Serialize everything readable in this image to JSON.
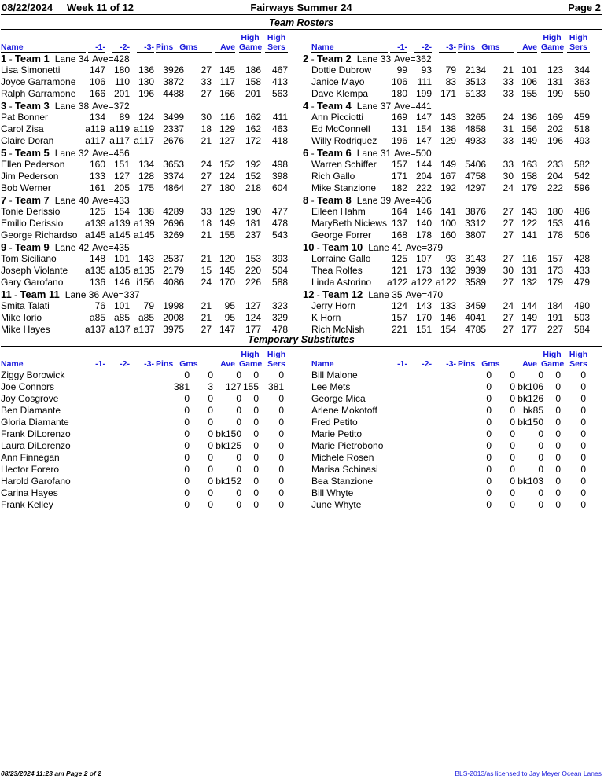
{
  "header": {
    "date": "08/22/2024",
    "week": "Week 11 of 12",
    "league": "Fairways Summer 24",
    "page": "Page 2"
  },
  "sections": {
    "rosters_title": "Team Rosters",
    "subs_title": "Temporary Substitutes"
  },
  "columns": {
    "name": "Name",
    "g1": "-1-",
    "g2": "-2-",
    "g3": "-3-",
    "pins": "Pins",
    "gms": "Gms",
    "ave": "Ave",
    "high_game": "High Game",
    "high_game_1": "High",
    "high_game_2": "Game",
    "high_sers_1": "High",
    "high_sers_2": "Sers"
  },
  "teams_left": [
    {
      "num": "1",
      "name": "Team 1",
      "lane": "Lane 34",
      "ave": "Ave=428",
      "bowlers": [
        {
          "name": "Lisa Simonetti",
          "g1": "147",
          "g2": "180",
          "g3": "136",
          "pins": "3926",
          "gms": "27",
          "ave": "145",
          "hg": "186",
          "hs": "467"
        },
        {
          "name": "Joyce Garramone",
          "g1": "106",
          "g2": "110",
          "g3": "130",
          "pins": "3872",
          "gms": "33",
          "ave": "117",
          "hg": "158",
          "hs": "413"
        },
        {
          "name": "Ralph Garramone",
          "g1": "166",
          "g2": "201",
          "g3": "196",
          "pins": "4488",
          "gms": "27",
          "ave": "166",
          "hg": "201",
          "hs": "563"
        }
      ]
    },
    {
      "num": "3",
      "name": "Team 3",
      "lane": "Lane 38",
      "ave": "Ave=372",
      "bowlers": [
        {
          "name": "Pat Bonner",
          "g1": "134",
          "g2": "89",
          "g3": "124",
          "pins": "3499",
          "gms": "30",
          "ave": "116",
          "hg": "162",
          "hs": "411"
        },
        {
          "name": "Carol Zisa",
          "g1": "a119",
          "g2": "a119",
          "g3": "a119",
          "pins": "2337",
          "gms": "18",
          "ave": "129",
          "hg": "162",
          "hs": "463"
        },
        {
          "name": "Claire Doran",
          "g1": "a117",
          "g2": "a117",
          "g3": "a117",
          "pins": "2676",
          "gms": "21",
          "ave": "127",
          "hg": "172",
          "hs": "418"
        }
      ]
    },
    {
      "num": "5",
      "name": "Team 5",
      "lane": "Lane 32",
      "ave": "Ave=456",
      "bowlers": [
        {
          "name": "Ellen Pederson",
          "g1": "160",
          "g2": "151",
          "g3": "134",
          "pins": "3653",
          "gms": "24",
          "ave": "152",
          "hg": "192",
          "hs": "498"
        },
        {
          "name": "Jim Pederson",
          "g1": "133",
          "g2": "127",
          "g3": "128",
          "pins": "3374",
          "gms": "27",
          "ave": "124",
          "hg": "152",
          "hs": "398"
        },
        {
          "name": "Bob Werner",
          "g1": "161",
          "g2": "205",
          "g3": "175",
          "pins": "4864",
          "gms": "27",
          "ave": "180",
          "hg": "218",
          "hs": "604"
        }
      ]
    },
    {
      "num": "7",
      "name": "Team 7",
      "lane": "Lane 40",
      "ave": "Ave=433",
      "bowlers": [
        {
          "name": "Tonie Derissio",
          "g1": "125",
          "g2": "154",
          "g3": "138",
          "pins": "4289",
          "gms": "33",
          "ave": "129",
          "hg": "190",
          "hs": "477"
        },
        {
          "name": "Emilio Derissio",
          "g1": "a139",
          "g2": "a139",
          "g3": "a139",
          "pins": "2696",
          "gms": "18",
          "ave": "149",
          "hg": "181",
          "hs": "478"
        },
        {
          "name": "George Richardso",
          "g1": "a145",
          "g2": "a145",
          "g3": "a145",
          "pins": "3269",
          "gms": "21",
          "ave": "155",
          "hg": "237",
          "hs": "543"
        }
      ]
    },
    {
      "num": "9",
      "name": "Team 9",
      "lane": "Lane 42",
      "ave": "Ave=435",
      "bowlers": [
        {
          "name": "Tom Siciliano",
          "g1": "148",
          "g2": "101",
          "g3": "143",
          "pins": "2537",
          "gms": "21",
          "ave": "120",
          "hg": "153",
          "hs": "393"
        },
        {
          "name": "Joseph Violante",
          "g1": "a135",
          "g2": "a135",
          "g3": "a135",
          "pins": "2179",
          "gms": "15",
          "ave": "145",
          "hg": "220",
          "hs": "504"
        },
        {
          "name": "Gary Garofano",
          "g1": "136",
          "g2": "146",
          "g3": "i156",
          "pins": "4086",
          "gms": "24",
          "ave": "170",
          "hg": "226",
          "hs": "588"
        }
      ]
    },
    {
      "num": "11",
      "name": "Team 11",
      "lane": "Lane 36",
      "ave": "Ave=337",
      "bowlers": [
        {
          "name": "Smita Talati",
          "g1": "76",
          "g2": "101",
          "g3": "79",
          "pins": "1998",
          "gms": "21",
          "ave": "95",
          "hg": "127",
          "hs": "323"
        },
        {
          "name": "Mike Iorio",
          "g1": "a85",
          "g2": "a85",
          "g3": "a85",
          "pins": "2008",
          "gms": "21",
          "ave": "95",
          "hg": "124",
          "hs": "329"
        },
        {
          "name": "Mike Hayes",
          "g1": "a137",
          "g2": "a137",
          "g3": "a137",
          "pins": "3975",
          "gms": "27",
          "ave": "147",
          "hg": "177",
          "hs": "478"
        }
      ]
    }
  ],
  "teams_right": [
    {
      "num": "2",
      "name": "Team 2",
      "lane": "Lane 33",
      "ave": "Ave=362",
      "bowlers": [
        {
          "name": "Dottie Dubrow",
          "g1": "99",
          "g2": "93",
          "g3": "79",
          "pins": "2134",
          "gms": "21",
          "ave": "101",
          "hg": "123",
          "hs": "344"
        },
        {
          "name": "Janice Mayo",
          "g1": "106",
          "g2": "111",
          "g3": "83",
          "pins": "3513",
          "gms": "33",
          "ave": "106",
          "hg": "131",
          "hs": "363"
        },
        {
          "name": "Dave Klempa",
          "g1": "180",
          "g2": "199",
          "g3": "171",
          "pins": "5133",
          "gms": "33",
          "ave": "155",
          "hg": "199",
          "hs": "550"
        }
      ]
    },
    {
      "num": "4",
      "name": "Team 4",
      "lane": "Lane 37",
      "ave": "Ave=441",
      "bowlers": [
        {
          "name": "Ann Picciotti",
          "g1": "169",
          "g2": "147",
          "g3": "143",
          "pins": "3265",
          "gms": "24",
          "ave": "136",
          "hg": "169",
          "hs": "459"
        },
        {
          "name": "Ed McConnell",
          "g1": "131",
          "g2": "154",
          "g3": "138",
          "pins": "4858",
          "gms": "31",
          "ave": "156",
          "hg": "202",
          "hs": "518"
        },
        {
          "name": "Willy Rodriquez",
          "g1": "196",
          "g2": "147",
          "g3": "129",
          "pins": "4933",
          "gms": "33",
          "ave": "149",
          "hg": "196",
          "hs": "493"
        }
      ]
    },
    {
      "num": "6",
      "name": "Team 6",
      "lane": "Lane 31",
      "ave": "Ave=500",
      "bowlers": [
        {
          "name": "Warren Schiffer",
          "g1": "157",
          "g2": "144",
          "g3": "149",
          "pins": "5406",
          "gms": "33",
          "ave": "163",
          "hg": "233",
          "hs": "582"
        },
        {
          "name": "Rich Gallo",
          "g1": "171",
          "g2": "204",
          "g3": "167",
          "pins": "4758",
          "gms": "30",
          "ave": "158",
          "hg": "204",
          "hs": "542"
        },
        {
          "name": "Mike Stanzione",
          "g1": "182",
          "g2": "222",
          "g3": "192",
          "pins": "4297",
          "gms": "24",
          "ave": "179",
          "hg": "222",
          "hs": "596"
        }
      ]
    },
    {
      "num": "8",
      "name": "Team 8",
      "lane": "Lane 39",
      "ave": "Ave=406",
      "bowlers": [
        {
          "name": "Eileen Hahm",
          "g1": "164",
          "g2": "146",
          "g3": "141",
          "pins": "3876",
          "gms": "27",
          "ave": "143",
          "hg": "180",
          "hs": "486"
        },
        {
          "name": "MaryBeth Niciews",
          "g1": "137",
          "g2": "140",
          "g3": "100",
          "pins": "3312",
          "gms": "27",
          "ave": "122",
          "hg": "153",
          "hs": "416"
        },
        {
          "name": "George Forrer",
          "g1": "168",
          "g2": "178",
          "g3": "160",
          "pins": "3807",
          "gms": "27",
          "ave": "141",
          "hg": "178",
          "hs": "506"
        }
      ]
    },
    {
      "num": "10",
      "name": "Team 10",
      "lane": "Lane 41",
      "ave": "Ave=379",
      "bowlers": [
        {
          "name": "Lorraine Gallo",
          "g1": "125",
          "g2": "107",
          "g3": "93",
          "pins": "3143",
          "gms": "27",
          "ave": "116",
          "hg": "157",
          "hs": "428"
        },
        {
          "name": "Thea Rolfes",
          "g1": "121",
          "g2": "173",
          "g3": "132",
          "pins": "3939",
          "gms": "30",
          "ave": "131",
          "hg": "173",
          "hs": "433"
        },
        {
          "name": "Linda Astorino",
          "g1": "a122",
          "g2": "a122",
          "g3": "a122",
          "pins": "3589",
          "gms": "27",
          "ave": "132",
          "hg": "179",
          "hs": "479"
        }
      ]
    },
    {
      "num": "12",
      "name": "Team 12",
      "lane": "Lane 35",
      "ave": "Ave=470",
      "bowlers": [
        {
          "name": "Jerry Horn",
          "g1": "124",
          "g2": "143",
          "g3": "133",
          "pins": "3459",
          "gms": "24",
          "ave": "144",
          "hg": "184",
          "hs": "490"
        },
        {
          "name": "K Horn",
          "g1": "157",
          "g2": "170",
          "g3": "146",
          "pins": "4041",
          "gms": "27",
          "ave": "149",
          "hg": "191",
          "hs": "503"
        },
        {
          "name": "Rich McNish",
          "g1": "221",
          "g2": "151",
          "g3": "154",
          "pins": "4785",
          "gms": "27",
          "ave": "177",
          "hg": "227",
          "hs": "584"
        }
      ]
    }
  ],
  "subs_left": [
    {
      "name": "Ziggy Borowick",
      "pins": "0",
      "gms": "0",
      "ave": "0",
      "hg": "0",
      "hs": "0"
    },
    {
      "name": "Joe Connors",
      "pins": "381",
      "gms": "3",
      "ave": "127",
      "hg": "155",
      "hs": "381"
    },
    {
      "name": "Joy Cosgrove",
      "pins": "0",
      "gms": "0",
      "ave": "0",
      "hg": "0",
      "hs": "0"
    },
    {
      "name": "Ben Diamante",
      "pins": "0",
      "gms": "0",
      "ave": "0",
      "hg": "0",
      "hs": "0"
    },
    {
      "name": "Gloria Diamante",
      "pins": "0",
      "gms": "0",
      "ave": "0",
      "hg": "0",
      "hs": "0"
    },
    {
      "name": "Frank DiLorenzo",
      "pins": "0",
      "gms": "0",
      "ave": "bk150",
      "hg": "0",
      "hs": "0"
    },
    {
      "name": "Laura DiLorenzo",
      "pins": "0",
      "gms": "0",
      "ave": "bk125",
      "hg": "0",
      "hs": "0"
    },
    {
      "name": "Ann Finnegan",
      "pins": "0",
      "gms": "0",
      "ave": "0",
      "hg": "0",
      "hs": "0"
    },
    {
      "name": "Hector Forero",
      "pins": "0",
      "gms": "0",
      "ave": "0",
      "hg": "0",
      "hs": "0"
    },
    {
      "name": "Harold Garofano",
      "pins": "0",
      "gms": "0",
      "ave": "bk152",
      "hg": "0",
      "hs": "0"
    },
    {
      "name": "Carina Hayes",
      "pins": "0",
      "gms": "0",
      "ave": "0",
      "hg": "0",
      "hs": "0"
    },
    {
      "name": "Frank Kelley",
      "pins": "0",
      "gms": "0",
      "ave": "0",
      "hg": "0",
      "hs": "0"
    }
  ],
  "subs_right": [
    {
      "name": "Bill Malone",
      "pins": "0",
      "gms": "0",
      "ave": "0",
      "hg": "0",
      "hs": "0"
    },
    {
      "name": "Lee Mets",
      "pins": "0",
      "gms": "0",
      "ave": "bk106",
      "hg": "0",
      "hs": "0"
    },
    {
      "name": "George Mica",
      "pins": "0",
      "gms": "0",
      "ave": "bk126",
      "hg": "0",
      "hs": "0"
    },
    {
      "name": "Arlene Mokotoff",
      "pins": "0",
      "gms": "0",
      "ave": "bk85",
      "hg": "0",
      "hs": "0"
    },
    {
      "name": "Fred Petito",
      "pins": "0",
      "gms": "0",
      "ave": "bk150",
      "hg": "0",
      "hs": "0"
    },
    {
      "name": "Marie Petito",
      "pins": "0",
      "gms": "0",
      "ave": "0",
      "hg": "0",
      "hs": "0"
    },
    {
      "name": "Marie Pietrobono",
      "pins": "0",
      "gms": "0",
      "ave": "0",
      "hg": "0",
      "hs": "0"
    },
    {
      "name": "Michele Rosen",
      "pins": "0",
      "gms": "0",
      "ave": "0",
      "hg": "0",
      "hs": "0"
    },
    {
      "name": "Marisa Schinasi",
      "pins": "0",
      "gms": "0",
      "ave": "0",
      "hg": "0",
      "hs": "0"
    },
    {
      "name": "Bea Stanzione",
      "pins": "0",
      "gms": "0",
      "ave": "bk103",
      "hg": "0",
      "hs": "0"
    },
    {
      "name": "Bill Whyte",
      "pins": "0",
      "gms": "0",
      "ave": "0",
      "hg": "0",
      "hs": "0"
    },
    {
      "name": "June Whyte",
      "pins": "0",
      "gms": "0",
      "ave": "0",
      "hg": "0",
      "hs": "0"
    }
  ],
  "footer": {
    "printed": "08/23/2024  11:23 am  Page 2 of 2",
    "license": "BLS-2013/as licensed to Jay Meyer  Ocean Lanes"
  }
}
